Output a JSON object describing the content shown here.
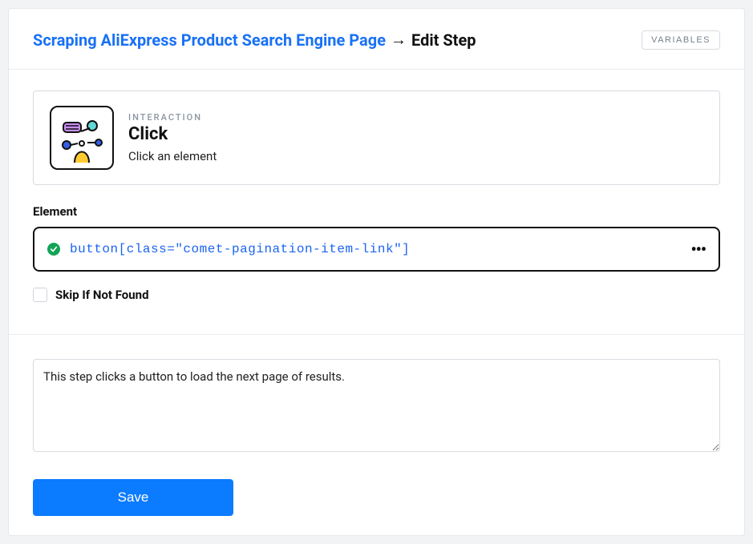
{
  "header": {
    "breadcrumb_link": "Scraping AliExpress Product Search Engine Page",
    "breadcrumb_arrow": "→",
    "breadcrumb_current": "Edit Step",
    "variables_label": "VARIABLES"
  },
  "interaction": {
    "category": "INTERACTION",
    "title": "Click",
    "subtitle": "Click an element"
  },
  "element": {
    "label": "Element",
    "selector_tag": "button",
    "selector_attr": "[class=\"comet-pagination-item-link\"]",
    "more_label": "•••"
  },
  "skip": {
    "label": "Skip If Not Found",
    "checked": false
  },
  "description": {
    "value": "This step clicks a button to load the next page of results."
  },
  "actions": {
    "save_label": "Save"
  }
}
